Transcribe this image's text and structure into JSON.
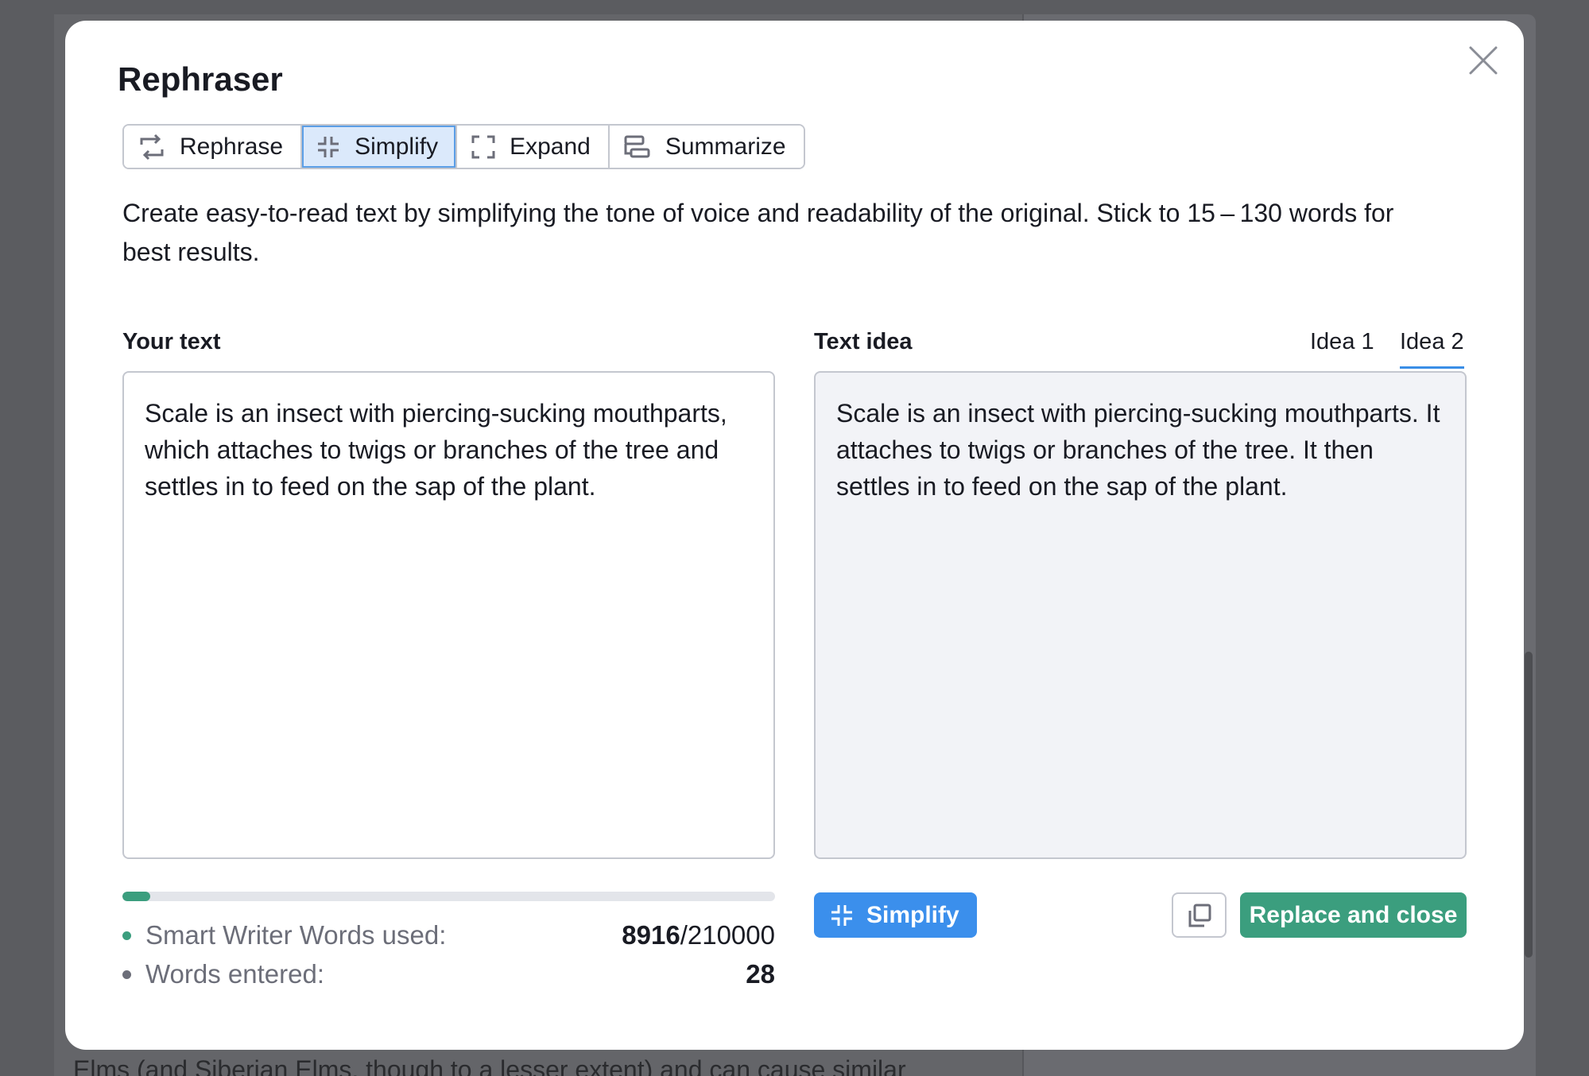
{
  "background": {
    "text": "Elms (and Siberian Elms, though to a lesser extent) and can cause similar"
  },
  "modal": {
    "title": "Rephraser",
    "close_icon": "close-icon"
  },
  "tabs": [
    {
      "label": "Rephrase",
      "icon": "rephrase-icon",
      "active": false
    },
    {
      "label": "Simplify",
      "icon": "simplify-icon",
      "active": true
    },
    {
      "label": "Expand",
      "icon": "expand-icon",
      "active": false
    },
    {
      "label": "Summarize",
      "icon": "summarize-icon",
      "active": false
    }
  ],
  "description": "Create easy-to-read text by simplifying the tone of voice and readability of the original. Stick to 15 – 130 words for best results.",
  "input": {
    "label": "Your text",
    "value": "Scale is an insect with piercing-sucking mouthparts, which attaches to twigs or branches of the tree and settles in to feed on the sap of the plant."
  },
  "output": {
    "label": "Text idea",
    "ideas": [
      "Idea 1",
      "Idea 2"
    ],
    "active_idea": 1,
    "value": "Scale is an insect with piercing-sucking mouthparts. It attaches to twigs or branches of the tree. It then settles in to feed on the sap of the plant."
  },
  "usage": {
    "progress_fraction": 0.0425,
    "words_used_label": "Smart Writer Words used:",
    "words_used": "8916",
    "words_limit": "/210000",
    "words_entered_label": "Words entered:",
    "words_entered": "28",
    "dot_colors": {
      "used": "#3b9e7e",
      "entered": "#6c6e79"
    }
  },
  "actions": {
    "simplify_label": "Simplify",
    "replace_label": "Replace and close",
    "copy_icon": "copy-icon"
  },
  "colors": {
    "primary_blue": "#3b8fec",
    "success_green": "#3b9e7e",
    "active_tab_bg": "#dbe9fb"
  }
}
